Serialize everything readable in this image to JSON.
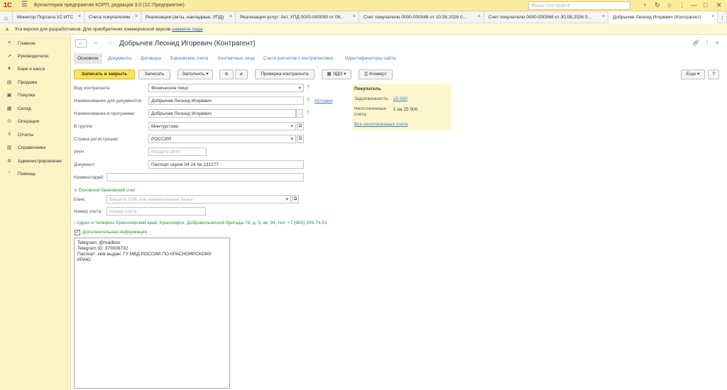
{
  "app": {
    "logo": "1С",
    "title": "Бухгалтерия предприятия КОРП, редакция 3.0  (1С:Предприятие)",
    "search_placeholder": "Поиск Ctrl+Shift+F"
  },
  "tabs": [
    {
      "label": "Монитор Портала 1С:ИТС"
    },
    {
      "label": "Счета покупателям"
    },
    {
      "label": "Реализация (акты, накладные, УПД)"
    },
    {
      "label": "Реализация услуг: Акт, УПД 0000-000059 от 06..."
    },
    {
      "label": "Счет покупателю 0000-000046 от 10.08.2026 0..."
    },
    {
      "label": "Счет покупателю 0000-000068 от 30.08.2026 0..."
    },
    {
      "label": "Добрычев Леонид Игоревич (Контрагент)"
    }
  ],
  "warning": {
    "text": "Эта версия для разработчиков. Для приобретения коммерческой версии",
    "link": "нажмите сюда"
  },
  "sidebar": {
    "items": [
      {
        "label": "Главное",
        "icon": "menu-icon"
      },
      {
        "label": "Руководителю",
        "icon": "trend-icon"
      },
      {
        "label": "Банк и касса",
        "icon": "bank-icon"
      },
      {
        "label": "Продажи",
        "icon": "sales-icon"
      },
      {
        "label": "Покупки",
        "icon": "cart-icon"
      },
      {
        "label": "Склад",
        "icon": "warehouse-icon"
      },
      {
        "label": "Операции",
        "icon": "operations-icon"
      },
      {
        "label": "Отчеты",
        "icon": "chart-icon"
      },
      {
        "label": "Справочники",
        "icon": "book-icon"
      },
      {
        "label": "Администрирование",
        "icon": "gear-icon"
      },
      {
        "label": "Помощь",
        "icon": "help-icon"
      }
    ]
  },
  "form": {
    "title": "Добрычев Леонид Игоревич (Контрагент)",
    "subtabs": [
      "Основное",
      "Документы",
      "Договоры",
      "Банковские счета",
      "Контактные лица",
      "Счета расчетов с контрагентами",
      "Идентификаторы сайта"
    ],
    "toolbar": {
      "save_close": "Записать и закрыть",
      "save": "Записать",
      "fill": "Заполнить",
      "check": "Проверка контрагента",
      "edo": "ЭДО",
      "envelope": "Конверт",
      "more": "Еще",
      "help": "?"
    },
    "fields": {
      "kind_label": "Вид контрагента:",
      "kind_value": "Физическое лицо",
      "docname_label": "Наименование для документов:",
      "docname_value": "Добрычев Леонид Игоревич",
      "history": "История",
      "progname_label": "Наименование в программе:",
      "progname_value": "Добрычев Леонид Игоревич",
      "group_label": "В группе:",
      "group_value": "Минтургтово",
      "country_label": "Страна регистрации:",
      "country_value": "РОССИЯ",
      "inn_label": "ИНН",
      "inn_placeholder": "Введите ИНН",
      "doc_label": "Документ:",
      "doc_value": "Паспорт серия 04 24 № 131277",
      "comment_label": "Комментарий:",
      "bank_section": "Основной банковский счет",
      "bank_label": "Банк:",
      "bank_placeholder": "Введите БИК или наименование банка",
      "account_label": "Номер счета:",
      "account_placeholder": "Номер счета",
      "address_section": "Адрес и телефон:",
      "address_value": "Красноярский край, Красноярск, Добровольческой бригады 78, д. 5, кв. 94, тел: +7 (983) 209-74-51",
      "extra_section": "Дополнительная информация",
      "notes": [
        "Telegram: @readbox",
        "Telegram ID: 370006732",
        "Паспорт: кем выдан: ГУ МВД РОССИИ ПО КРАСНОЯРСКОМУ",
        "КРАЮ"
      ]
    },
    "buyer": {
      "title": "Покупатель",
      "debt_label": "Задолженность:",
      "debt_value": "25 000",
      "unpaid_label1": "Неоплаченные",
      "unpaid_label2": "счета:",
      "unpaid_value": "1 на 25 000",
      "all_unpaid_link": "Все неоплаченные счета"
    }
  }
}
